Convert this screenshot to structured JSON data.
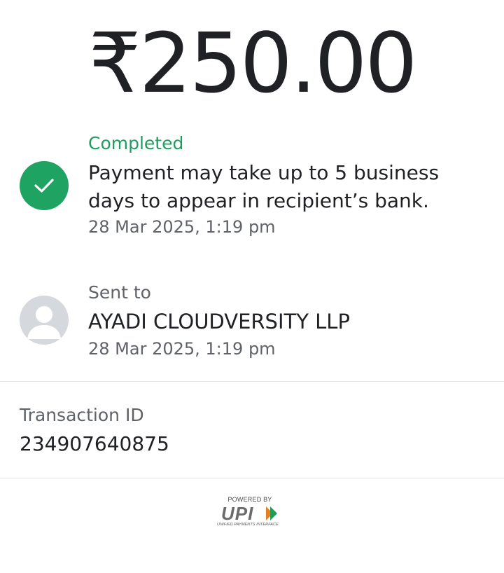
{
  "payment": {
    "amount": "₹250.00"
  },
  "status": {
    "label": "Completed",
    "message": "Payment may take up to 5 business days to appear in recipient’s bank.",
    "timestamp": "28 Mar 2025, 1:19 pm",
    "icon": "check-circle-icon",
    "color": "#1ea362"
  },
  "recipient": {
    "label": "Sent to",
    "name": "AYADI CLOUDVERSITY LLP",
    "timestamp": "28 Mar 2025, 1:19 pm",
    "icon": "avatar-placeholder-icon"
  },
  "transaction": {
    "label": "Transaction ID",
    "id": "234907640875"
  },
  "footer": {
    "powered_by": "POWERED BY",
    "brand": "UPI",
    "tagline": "UNIFIED PAYMENTS INTERFACE"
  }
}
